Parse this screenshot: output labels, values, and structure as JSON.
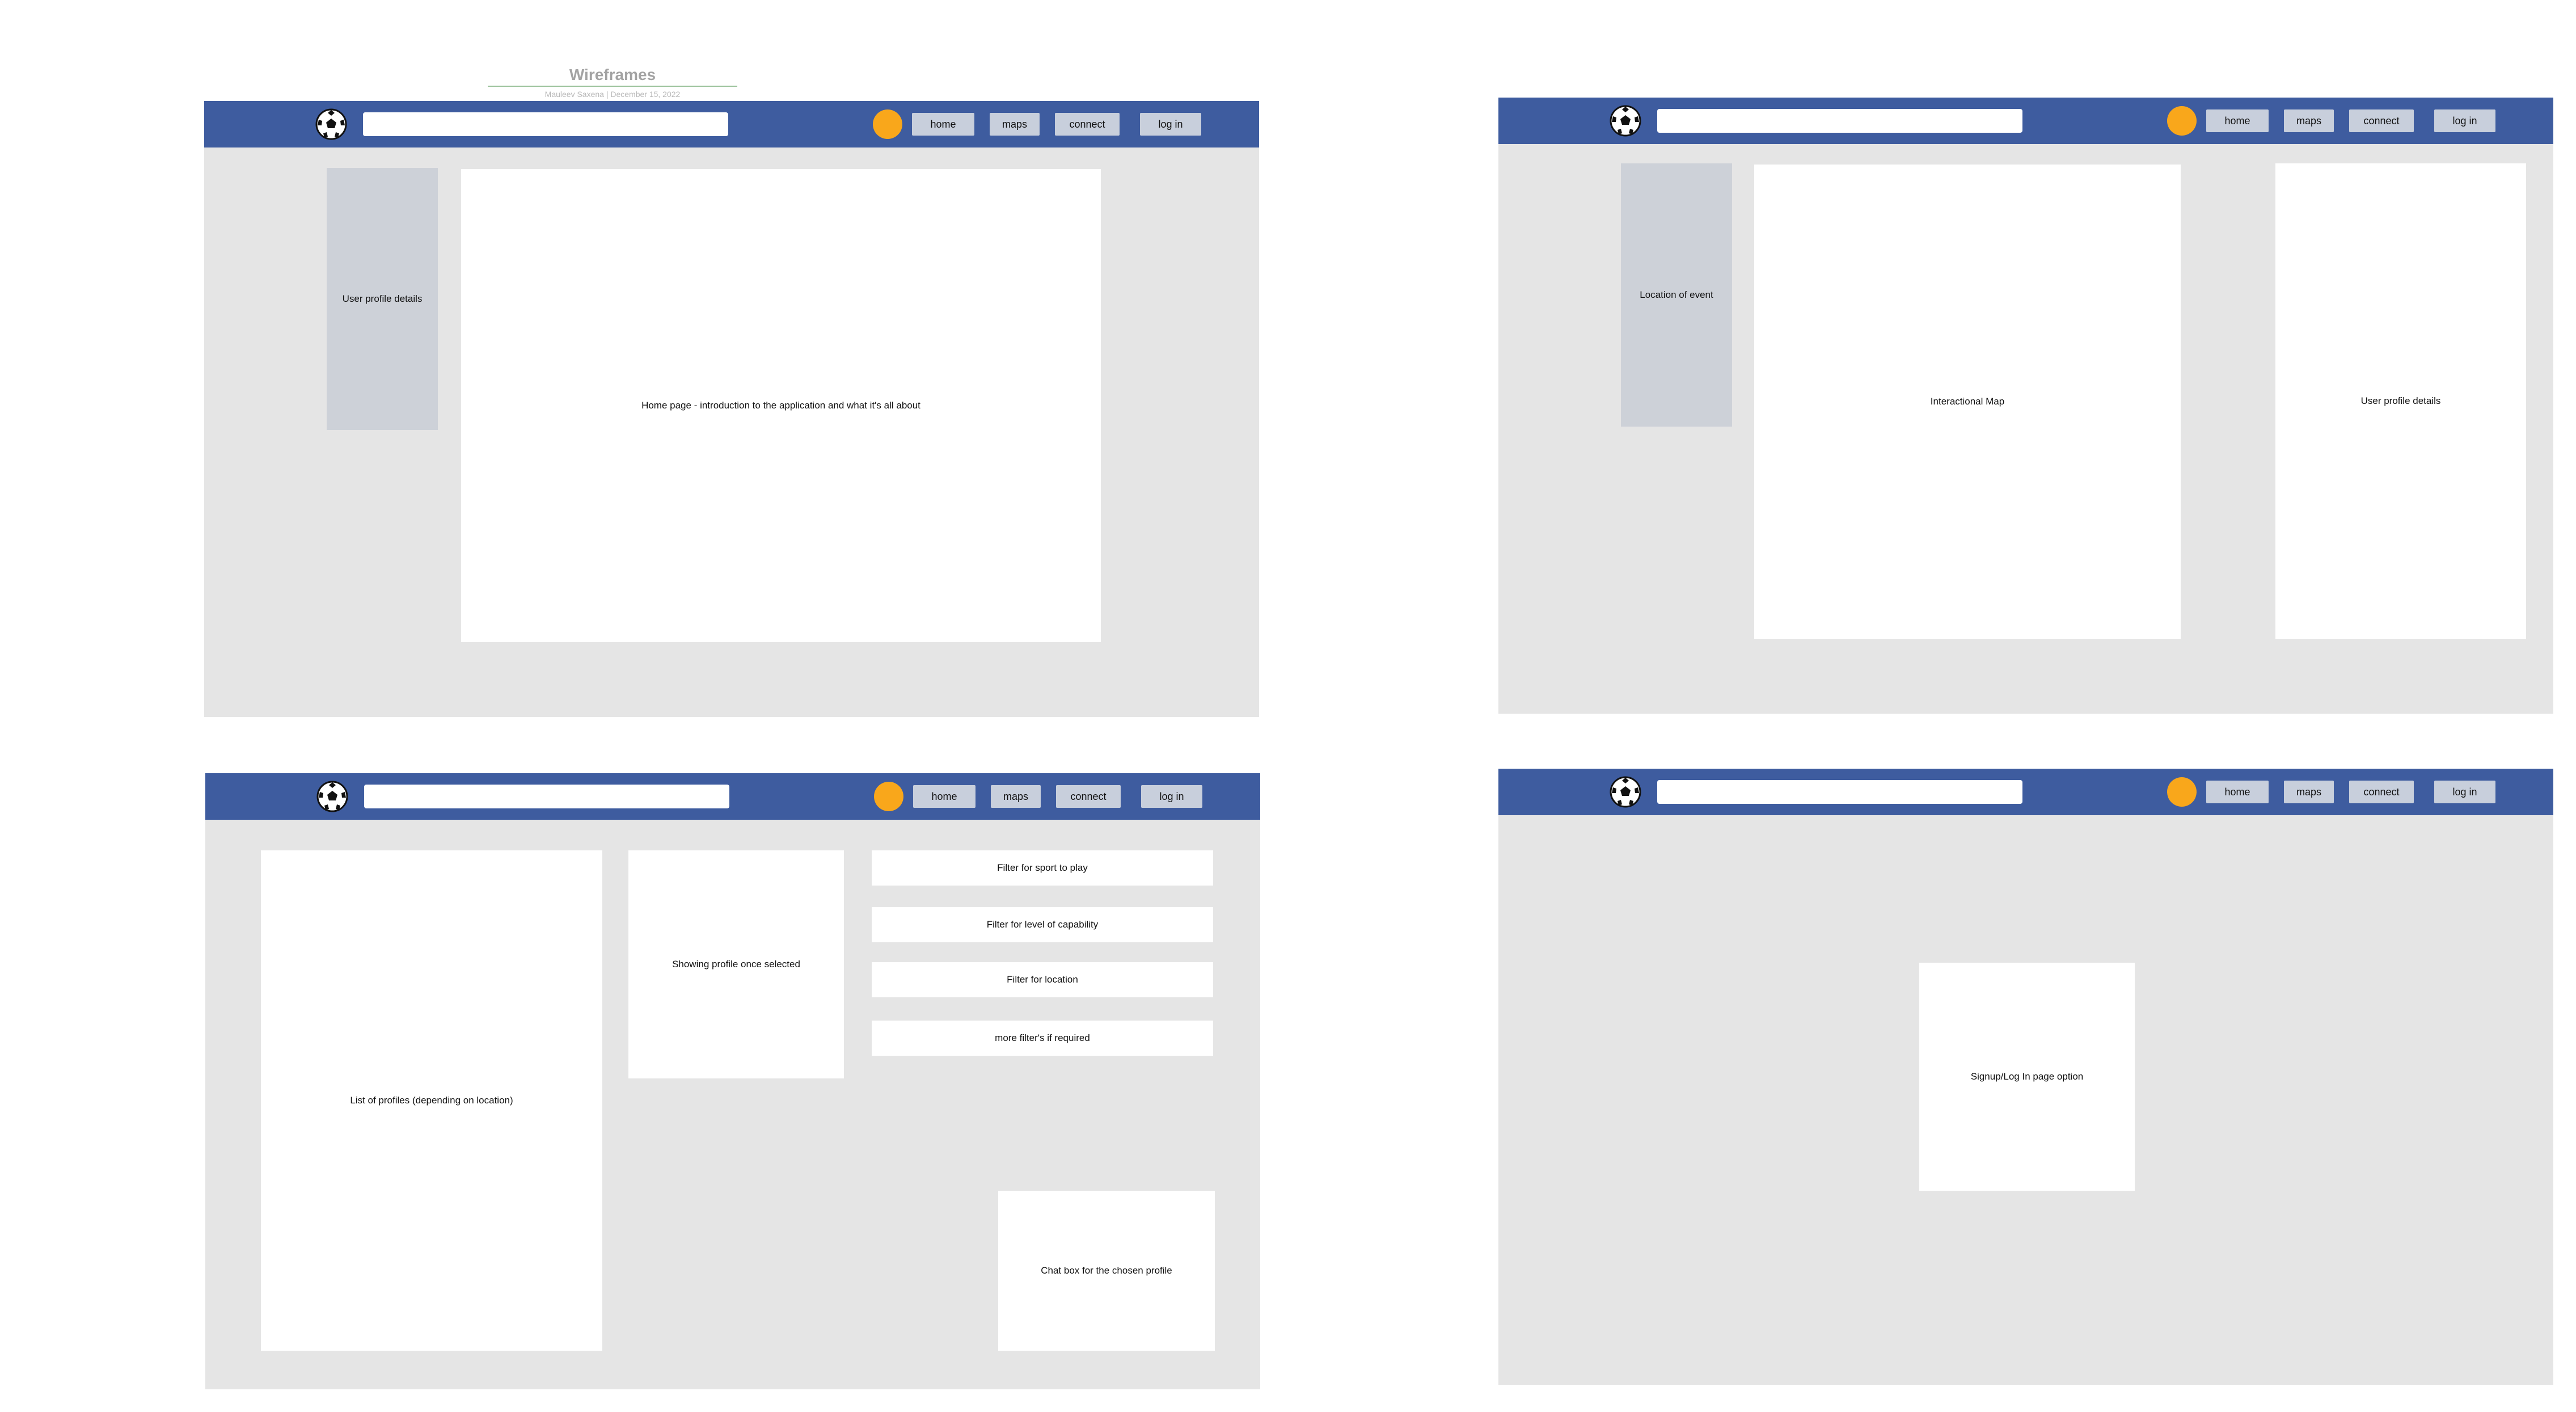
{
  "page": {
    "title": "Wireframes",
    "subtitle": "Mauleev Saxena  |  December 15, 2022"
  },
  "colors": {
    "navbar": "#3e5c9f",
    "frame_bg": "#e5e5e5",
    "avatar": "#f9a71b",
    "nav_button": "#c8cfdc",
    "side_panel": "#cdd1d8"
  },
  "nav": {
    "logo_icon": "soccer-ball-icon",
    "search_value": "",
    "home": "home",
    "maps": "maps",
    "connect": "connect",
    "login": "log in"
  },
  "frame1": {
    "side_panel": "User profile details",
    "main_panel": "Home page - introduction to the application and what it's all about"
  },
  "frame2": {
    "side_panel": "Location of event",
    "map_panel": "Interactional Map",
    "right_panel": "User profile details"
  },
  "frame3": {
    "profiles_list": "List of profiles (depending on location)",
    "profile_preview": "Showing profile once selected",
    "filters": [
      "Filter for sport to play",
      "Filter for level of capability",
      "Filter for location",
      "more filter's if required"
    ],
    "chat_box": "Chat box for the chosen profile"
  },
  "frame4": {
    "signup_panel": "Signup/Log In page option"
  }
}
